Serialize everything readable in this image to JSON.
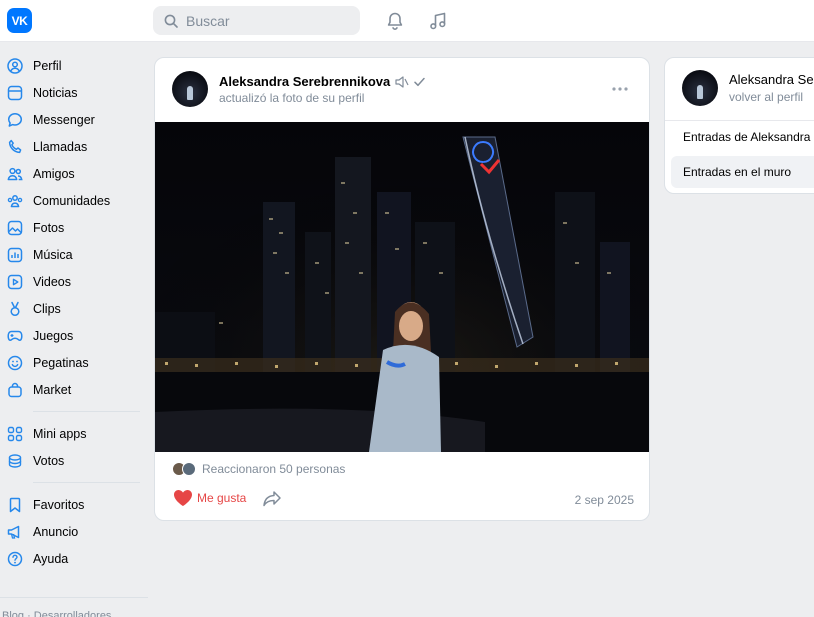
{
  "header": {
    "logo_text": "VK",
    "search_placeholder": "Buscar"
  },
  "sidebar": {
    "items": [
      {
        "label": "Perfil",
        "icon": "user-icon"
      },
      {
        "label": "Noticias",
        "icon": "news-icon"
      },
      {
        "label": "Messenger",
        "icon": "chat-icon"
      },
      {
        "label": "Llamadas",
        "icon": "phone-icon"
      },
      {
        "label": "Amigos",
        "icon": "friends-icon"
      },
      {
        "label": "Comunidades",
        "icon": "communities-icon"
      },
      {
        "label": "Fotos",
        "icon": "photo-icon"
      },
      {
        "label": "Música",
        "icon": "music-icon"
      },
      {
        "label": "Videos",
        "icon": "video-icon"
      },
      {
        "label": "Clips",
        "icon": "clips-icon"
      },
      {
        "label": "Juegos",
        "icon": "gamepad-icon"
      },
      {
        "label": "Pegatinas",
        "icon": "sticker-icon"
      },
      {
        "label": "Market",
        "icon": "bag-icon"
      }
    ],
    "items2": [
      {
        "label": "Mini apps",
        "icon": "apps-icon"
      },
      {
        "label": "Votos",
        "icon": "coins-icon"
      }
    ],
    "items3": [
      {
        "label": "Favoritos",
        "icon": "bookmark-icon"
      },
      {
        "label": "Anuncio",
        "icon": "megaphone-icon"
      },
      {
        "label": "Ayuda",
        "icon": "help-icon"
      }
    ],
    "footer_text": "Blog · Desarrolladores"
  },
  "post": {
    "author": "Aleksandra Serebrennikova",
    "action": "actualizó la foto de su perfil",
    "reactions_text": "Reaccionaron 50 personas",
    "like_label": "Me gusta",
    "date": "2 sep 2025"
  },
  "right_panel": {
    "name": "Aleksandra Serebrennikova",
    "back_link": "volver al perfil",
    "menu": [
      "Entradas de Aleksandra",
      "Entradas en el muro"
    ]
  },
  "colors": {
    "accent": "#0077ff",
    "icon": "#2688eb",
    "like": "#e64646",
    "secondary_text": "#818c99",
    "background": "#edeef0"
  }
}
